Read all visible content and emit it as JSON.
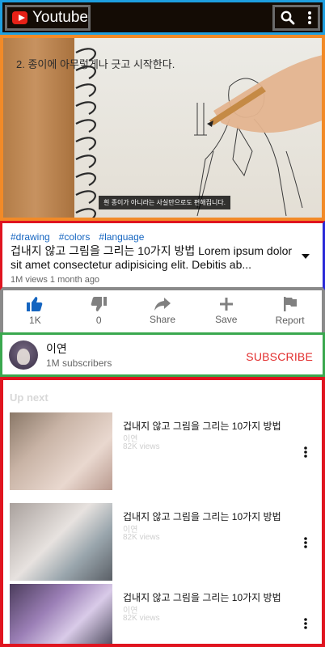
{
  "header": {
    "logo_text": "Youtube"
  },
  "video": {
    "overlay_title": "2. 종이에 아무렇게나 긋고 시작한다.",
    "caption": "흰 종이가 아니라는 사실만으로도 편해집니다."
  },
  "info": {
    "tags": [
      "#drawing",
      "#colors",
      "#language"
    ],
    "title": "겁내지 않고 그림을 그리는 10가지 방법 Lorem ipsum dolor sit amet consectetur adipisicing elit. Debitis ab...",
    "meta": "1M views 1 month ago"
  },
  "actions": {
    "like": "1K",
    "dislike": "0",
    "share": "Share",
    "save": "Save",
    "report": "Report"
  },
  "channel": {
    "name": "이연",
    "subscribers": "1M subscribers",
    "subscribe_label": "SUBSCRIBE"
  },
  "upnext": {
    "title": "Up next",
    "items": [
      {
        "title": "겁내지 않고 그림을 그리는 10가지 방법",
        "channel": "이연",
        "views": "82K views"
      },
      {
        "title": "겁내지 않고 그림을 그리는 10가지 방법",
        "channel": "이연",
        "views": "82K views"
      },
      {
        "title": "겁내지 않고 그림을 그리는 10가지 방법",
        "channel": "이연",
        "views": "82K views"
      }
    ]
  },
  "colors": {
    "accent": "#1565c0",
    "subscribe": "#e22e2e",
    "logo_red": "#e62117"
  }
}
